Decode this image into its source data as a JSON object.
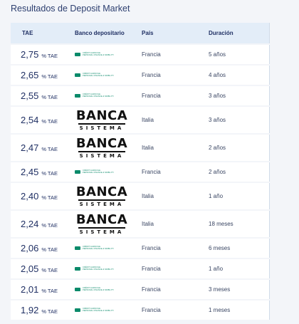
{
  "page": {
    "title": "Resultados de Deposit Market"
  },
  "table": {
    "headers": {
      "tae": "TAE",
      "bank": "Banco depositario",
      "country": "País",
      "duration": "Duración"
    },
    "logos": {
      "credit_agricole": {
        "line1": "CRÉDIT AGRICOLE",
        "line2": "PERSONAL FINANCE & MOBILITY"
      },
      "banca_sistema": {
        "top": "BANCA",
        "bottom": "SISTEMA"
      }
    },
    "rows": [
      {
        "rate": "2,75",
        "unit": "% TAE",
        "bank": "credit_agricole",
        "country": "Francia",
        "duration": "5 años"
      },
      {
        "rate": "2,65",
        "unit": "% TAE",
        "bank": "credit_agricole",
        "country": "Francia",
        "duration": "4 años"
      },
      {
        "rate": "2,55",
        "unit": "% TAE",
        "bank": "credit_agricole",
        "country": "Francia",
        "duration": "3 años"
      },
      {
        "rate": "2,54",
        "unit": "% TAE",
        "bank": "banca_sistema",
        "country": "Italia",
        "duration": "3 años"
      },
      {
        "rate": "2,47",
        "unit": "% TAE",
        "bank": "banca_sistema",
        "country": "Italia",
        "duration": "2 años"
      },
      {
        "rate": "2,45",
        "unit": "% TAE",
        "bank": "credit_agricole",
        "country": "Francia",
        "duration": "2 años"
      },
      {
        "rate": "2,40",
        "unit": "% TAE",
        "bank": "banca_sistema",
        "country": "Italia",
        "duration": "1 año"
      },
      {
        "rate": "2,24",
        "unit": "% TAE",
        "bank": "banca_sistema",
        "country": "Italia",
        "duration": "18 meses"
      },
      {
        "rate": "2,06",
        "unit": "% TAE",
        "bank": "credit_agricole",
        "country": "Francia",
        "duration": "6 meses"
      },
      {
        "rate": "2,05",
        "unit": "% TAE",
        "bank": "credit_agricole",
        "country": "Francia",
        "duration": "1 año"
      },
      {
        "rate": "2,01",
        "unit": "% TAE",
        "bank": "credit_agricole",
        "country": "Francia",
        "duration": "3 meses"
      },
      {
        "rate": "1,92",
        "unit": "% TAE",
        "bank": "credit_agricole",
        "country": "Francia",
        "duration": "1 meses"
      }
    ]
  }
}
